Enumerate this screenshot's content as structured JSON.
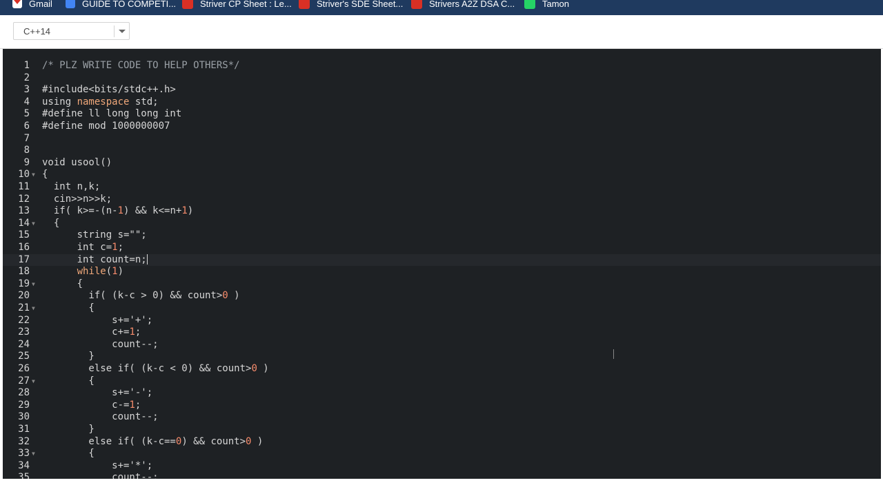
{
  "bookmarks": [
    {
      "label": "Gmail",
      "icon": "gmail-icon"
    },
    {
      "label": "GUIDE TO COMPETI...",
      "icon": "docs-icon"
    },
    {
      "label": "Striver CP Sheet : Le...",
      "icon": "tuf-icon"
    },
    {
      "label": "Striver's SDE Sheet...",
      "icon": "tuf-icon"
    },
    {
      "label": "Strivers A2Z DSA C...",
      "icon": "tuf-icon"
    },
    {
      "label": "Tamon",
      "icon": "whatsapp-icon"
    }
  ],
  "toolbar": {
    "language": "C++14"
  },
  "editor": {
    "active_line": 17,
    "lines": [
      {
        "n": "1",
        "text": "/* PLZ WRITE CODE TO HELP OTHERS*/"
      },
      {
        "n": "2",
        "text": ""
      },
      {
        "n": "3",
        "text": "#include<bits/stdc++.h>"
      },
      {
        "n": "4",
        "text": "using namespace std;"
      },
      {
        "n": "5",
        "text": "#define ll long long int"
      },
      {
        "n": "6",
        "text": "#define mod 1000000007"
      },
      {
        "n": "7",
        "text": ""
      },
      {
        "n": "8",
        "text": ""
      },
      {
        "n": "9",
        "text": "void usool()"
      },
      {
        "n": "10",
        "text": "{"
      },
      {
        "n": "11",
        "text": "  int n,k;"
      },
      {
        "n": "12",
        "text": "  cin>>n>>k;"
      },
      {
        "n": "13",
        "text": "  if( k>=-(n-1) && k<=n+1)"
      },
      {
        "n": "14",
        "text": "  {"
      },
      {
        "n": "15",
        "text": "      string s=\"\";"
      },
      {
        "n": "16",
        "text": "      int c=1;"
      },
      {
        "n": "17",
        "text": "      int count=n;"
      },
      {
        "n": "18",
        "text": "      while(1)"
      },
      {
        "n": "19",
        "text": "      {"
      },
      {
        "n": "20",
        "text": "        if( (k-c > 0) && count>0 )"
      },
      {
        "n": "21",
        "text": "        {"
      },
      {
        "n": "22",
        "text": "            s+='+';"
      },
      {
        "n": "23",
        "text": "            c+=1;"
      },
      {
        "n": "24",
        "text": "            count--;"
      },
      {
        "n": "25",
        "text": "        }"
      },
      {
        "n": "26",
        "text": "        else if( (k-c < 0) && count>0 )"
      },
      {
        "n": "27",
        "text": "        {"
      },
      {
        "n": "28",
        "text": "            s+='-';"
      },
      {
        "n": "29",
        "text": "            c-=1;"
      },
      {
        "n": "30",
        "text": "            count--;"
      },
      {
        "n": "31",
        "text": "        }"
      },
      {
        "n": "32",
        "text": "        else if( (k-c==0) && count>0 )"
      },
      {
        "n": "33",
        "text": "        {"
      },
      {
        "n": "34",
        "text": "            s+='*';"
      },
      {
        "n": "35",
        "text": "            count--;"
      }
    ],
    "fold_lines": [
      10,
      14,
      19,
      21,
      27,
      33
    ]
  },
  "colors": {
    "editor_bg": "#1e2124",
    "bookmarks_bg": "#1f3a5f",
    "keyword": "#f0a87a",
    "comment": "#9aa0a6"
  }
}
